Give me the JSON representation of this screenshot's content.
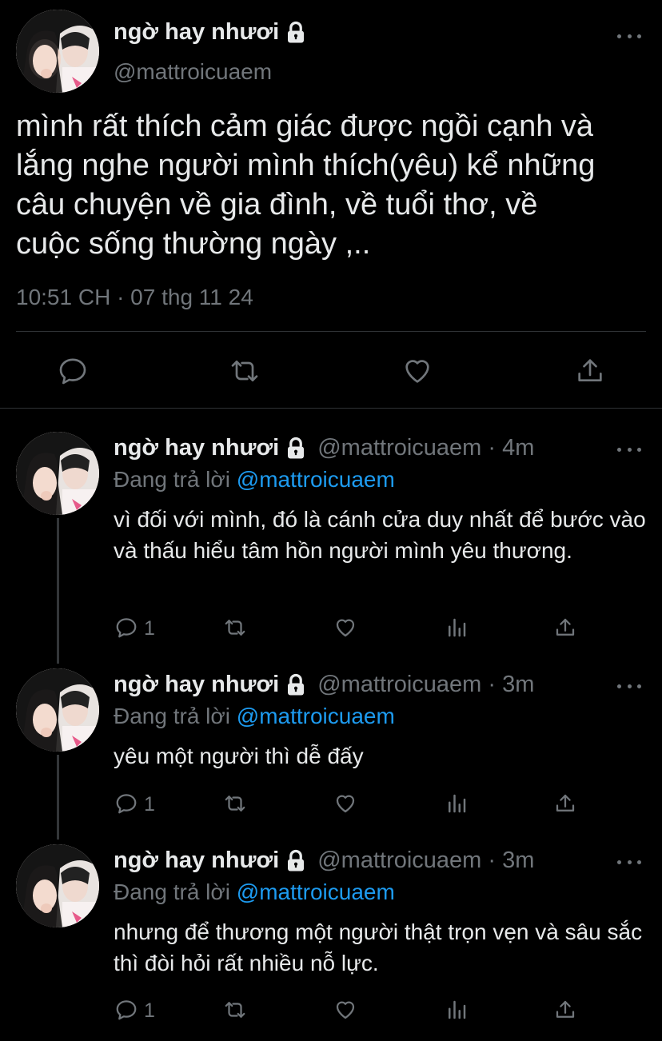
{
  "colors": {
    "background": "#000000",
    "text": "#E7E9EA",
    "muted": "#71767B",
    "link": "#1D9BF0",
    "divider": "#2F3336"
  },
  "main_tweet": {
    "display_name": "ngờ hay nhươi",
    "handle": "@mattroicuaem",
    "text": "mình rất thích cảm giác được ngồi cạnh và\nlắng nghe người mình thích(yêu) kể những\ncâu chuyện về gia đình, về tuổi thơ, về\ncuộc sống thường ngày ,..",
    "timestamp": "10:51 CH · 07 thg 11 24",
    "icons": [
      "lock-icon",
      "more-icon",
      "reply-icon",
      "retweet-icon",
      "like-icon",
      "share-icon"
    ]
  },
  "replies": [
    {
      "display_name": "ngờ hay nhươi",
      "meta": "@mattroicuaem · 4m",
      "replying_prefix": "Đang trả lời",
      "replying_to": "@mattroicuaem",
      "text": "vì đối với mình, đó là cánh cửa duy nhất để bước vào và thấu hiểu tâm hồn người mình yêu thương.",
      "reply_count": "1"
    },
    {
      "display_name": "ngờ hay nhươi",
      "meta": "@mattroicuaem · 3m",
      "replying_prefix": "Đang trả lời",
      "replying_to": "@mattroicuaem",
      "text": "yêu một người thì dễ đấy",
      "reply_count": "1"
    },
    {
      "display_name": "ngờ hay nhươi",
      "meta": "@mattroicuaem · 3m",
      "replying_prefix": "Đang trả lời",
      "replying_to": "@mattroicuaem",
      "text": "nhưng để thương một người thật trọn vẹn và sâu sắc thì đòi hỏi rất nhiều nỗ lực.",
      "reply_count": "1"
    }
  ]
}
